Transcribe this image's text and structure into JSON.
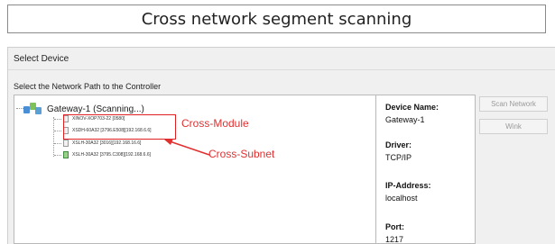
{
  "banner": {
    "title": "Cross network segment scanning"
  },
  "window": {
    "title": "Select Device",
    "section_label": "Select the Network Path to the Controller"
  },
  "tree": {
    "root_label": "Gateway-1 (Scanning...)",
    "items": [
      {
        "label": "XINOV-XOP703-22 [0580]"
      },
      {
        "label": "XSDH-60A32 [3796.E508][192.168.6.6]"
      },
      {
        "label": "XSLH-30A32 [3016][192.168.16.6]"
      },
      {
        "label": "XSLH-30A32 [3795.C308][192.168.6.6]"
      }
    ]
  },
  "annotations": {
    "cross_module": "Cross-Module",
    "cross_subnet": "Cross-Subnet",
    "color": "#e03030"
  },
  "info": {
    "device_name_label": "Device Name:",
    "device_name_value": "Gateway-1",
    "driver_label": "Driver:",
    "driver_value": "TCP/IP",
    "ip_label": "IP-Address:",
    "ip_value": "localhost",
    "port_label": "Port:",
    "port_value": "1217"
  },
  "buttons": {
    "scan_network": "Scan Network",
    "wink": "Wink"
  },
  "icons": {
    "root": "network-gateway-icon",
    "device": "device-icon",
    "arrow": "red-arrow"
  }
}
